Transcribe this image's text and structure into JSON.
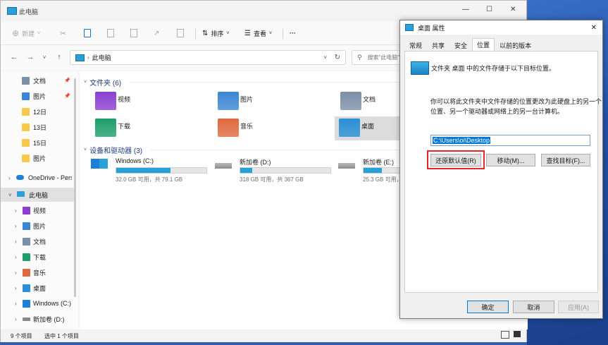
{
  "explorer": {
    "title": "此电脑",
    "toolbar": {
      "new_label": "新建",
      "sort_label": "排序",
      "view_label": "查看",
      "more_label": "···"
    },
    "address": {
      "path": "此电脑",
      "search_placeholder": "搜索\"此电脑\""
    },
    "nav": {
      "quick": [
        {
          "label": "文档",
          "icon": "documents-icon",
          "color": "#7b8fa8",
          "pinned": true
        },
        {
          "label": "图片",
          "icon": "pictures-icon",
          "color": "#3b86d4",
          "pinned": true
        },
        {
          "label": "12日",
          "icon": "folder-icon",
          "color": "#f6c84b",
          "pinned": false
        },
        {
          "label": "13日",
          "icon": "folder-icon",
          "color": "#f6c84b",
          "pinned": false
        },
        {
          "label": "15日",
          "icon": "folder-icon",
          "color": "#f6c84b",
          "pinned": false
        },
        {
          "label": "图片",
          "icon": "folder-icon",
          "color": "#f6c84b",
          "pinned": false
        }
      ],
      "onedrive_label": "OneDrive - Pers",
      "thispc_label": "此电脑",
      "thispc_children": [
        {
          "label": "视频",
          "icon": "videos-icon",
          "color": "#8b3fd0"
        },
        {
          "label": "图片",
          "icon": "pictures-icon",
          "color": "#3b86d4"
        },
        {
          "label": "文档",
          "icon": "documents-icon",
          "color": "#7b8fa8"
        },
        {
          "label": "下载",
          "icon": "downloads-icon",
          "color": "#1e9e6b"
        },
        {
          "label": "音乐",
          "icon": "music-icon",
          "color": "#e0693f"
        },
        {
          "label": "桌面",
          "icon": "desktop-icon",
          "color": "#2a8fd6"
        },
        {
          "label": "Windows (C:)",
          "icon": "windows-drive-icon",
          "color": "#1e7fd6"
        },
        {
          "label": "新加卷 (D:)",
          "icon": "drive-icon",
          "color": "#888888"
        }
      ]
    },
    "folders_header": "文件夹 (6)",
    "folders": [
      {
        "label": "视频",
        "icon": "videos-folder-icon",
        "color": "#8b3fd0"
      },
      {
        "label": "图片",
        "icon": "pictures-folder-icon",
        "color": "#3b86d4"
      },
      {
        "label": "文档",
        "icon": "documents-folder-icon",
        "color": "#7b8fa8"
      },
      {
        "label": "下载",
        "icon": "downloads-folder-icon",
        "color": "#1e9e6b"
      },
      {
        "label": "音乐",
        "icon": "music-folder-icon",
        "color": "#e0693f"
      },
      {
        "label": "桌面",
        "icon": "desktop-folder-icon",
        "color": "#2a8fd6"
      }
    ],
    "drives_header": "设备和驱动器 (3)",
    "drives": [
      {
        "name": "Windows (C:)",
        "info": "32.0 GB 可用，共 79.1 GB",
        "used_fraction": 0.6
      },
      {
        "name": "新加卷 (D:)",
        "info": "318 GB 可用，共 367 GB",
        "used_fraction": 0.13
      },
      {
        "name": "新加卷 (E:)",
        "info": "25.3 GB 可用，共 ",
        "used_fraction": 0.2
      }
    ],
    "status": {
      "count": "9 个项目",
      "selected": "选中 1 个项目"
    }
  },
  "dialog": {
    "title": "桌面 属性",
    "tabs": [
      "常规",
      "共享",
      "安全",
      "位置",
      "以前的版本"
    ],
    "active_tab": "位置",
    "info_line": "文件夹 桌面 中的文件存储于以下目标位置。",
    "desc_line1": "你可以将此文件夹中文件存储的位置更改为此硬盘上的另一个",
    "desc_line2": "位置、另一个驱动器或网络上的另一台计算机。",
    "path_value": "C:\\Users\\oi\\Desktop",
    "btn_restore": "还原默认值(R)",
    "btn_move": "移动(M)...",
    "btn_find": "查找目标(F)...",
    "btn_ok": "确定",
    "btn_cancel": "取消",
    "btn_apply": "应用(A)",
    "highlight_color": "#e5262a"
  }
}
